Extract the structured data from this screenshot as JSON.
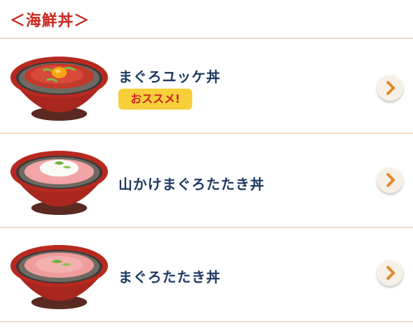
{
  "section": {
    "title": "＜海鮮丼＞"
  },
  "items": [
    {
      "name": "まぐろユッケ丼",
      "badge": "おススメ!",
      "image": "maguro-yukke-don"
    },
    {
      "name": "山かけまぐろたたき丼",
      "image": "yamakake-maguro-tataki-don"
    },
    {
      "name": "まぐろたたき丼",
      "image": "maguro-tataki-don"
    }
  ],
  "icons": {
    "arrow": "chevron-right-icon"
  },
  "colors": {
    "title_red": "#c8261e",
    "item_navy": "#1d3a63",
    "badge_yellow": "#f6cf3b",
    "divider": "#f3d9c9",
    "arrow_orange": "#e0892b"
  }
}
